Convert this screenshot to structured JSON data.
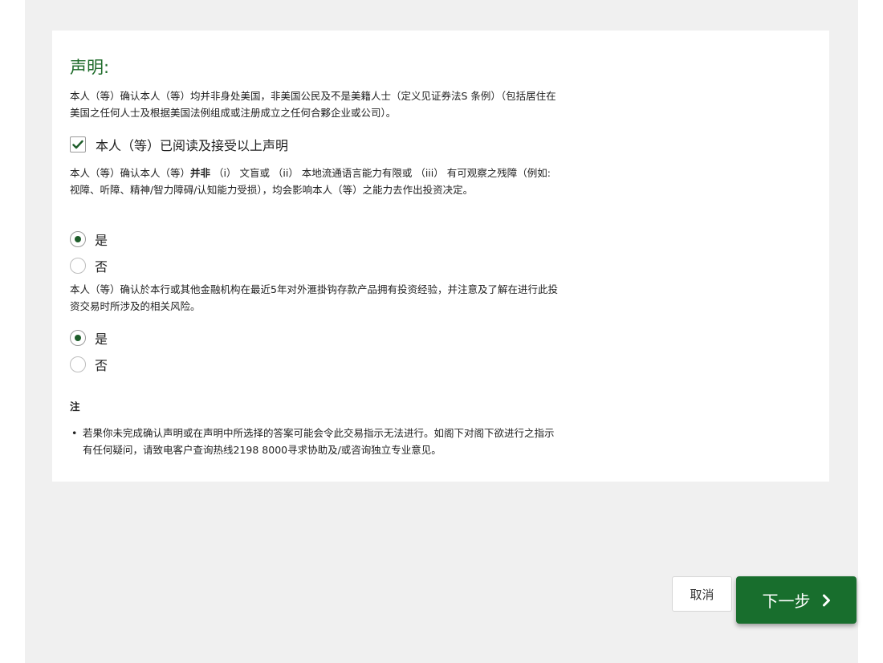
{
  "declaration": {
    "title": "声明:",
    "us_person_text": "本人（等）确认本人（等）均并非身处美国，非美国公民及不是美籍人士（定义见证券法S 条例）（包括居住在美国之任何人士及根据美国法例组成或注册成立之任何合夥企业或公司）。",
    "accept_label": "本人（等）已阅读及接受以上声明",
    "accept_checked": true
  },
  "question1": {
    "text_before": "本人（等）确认本人（等）",
    "text_bold": "并非",
    "text_after": " （i） 文盲或 （ii） 本地流通语言能力有限或 （iii） 有可观察之残障（例如: 视障、听障、精神/智力障碍/认知能力受损），均会影响本人（等）之能力去作出投资决定。",
    "options": [
      "是",
      "否"
    ],
    "selected": "是"
  },
  "question2": {
    "text": "本人（等）确认於本行或其他金融机构在最近5年对外滙掛钩存款产品拥有投资经验，并注意及了解在进行此投资交易时所涉及的相关风险。",
    "options": [
      "是",
      "否"
    ],
    "selected": "是"
  },
  "note": {
    "title": "注",
    "items": [
      "若果你未完成确认声明或在声明中所选择的答案可能会令此交易指示无法进行。如阁下对阁下欲进行之指示有任何疑问，请致电客户查询热线2198 8000寻求协助及/或咨询独立专业意见。"
    ]
  },
  "buttons": {
    "cancel_label": "取消",
    "next_label": "下一步"
  },
  "colors": {
    "accent": "#1e6b2a",
    "primary_button": "#186e2d",
    "page_background": "#f0f0f0"
  }
}
